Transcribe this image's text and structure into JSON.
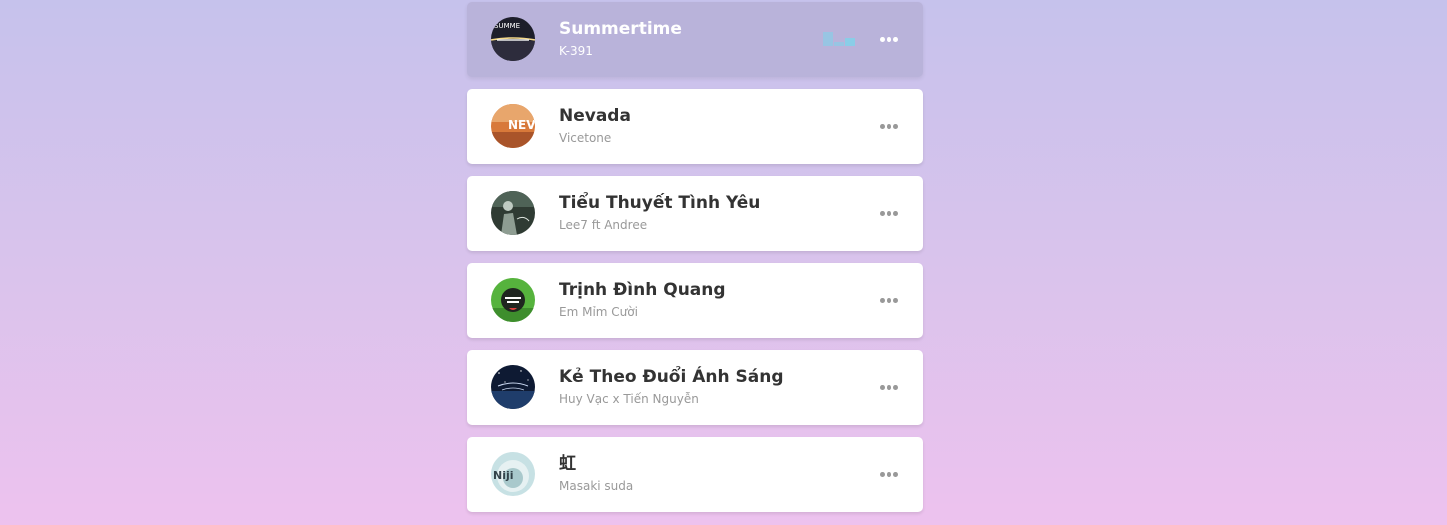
{
  "playlist": [
    {
      "title": "Summertime",
      "author": "K-391",
      "active": true,
      "icon": "more-horizontal-icon"
    },
    {
      "title": "Nevada",
      "author": "Vicetone",
      "active": false,
      "icon": "more-horizontal-icon"
    },
    {
      "title": "Tiểu Thuyết Tình Yêu",
      "author": "Lee7 ft Andree",
      "active": false,
      "icon": "more-horizontal-icon"
    },
    {
      "title": "Trịnh Đình Quang",
      "author": "Em Mỉm Cười",
      "active": false,
      "icon": "more-horizontal-icon"
    },
    {
      "title": "Kẻ Theo Đuổi Ánh Sáng",
      "author": "Huy Vạc x Tiến Nguyễn",
      "active": false,
      "icon": "more-horizontal-icon"
    },
    {
      "title": "虹",
      "author": "Masaki suda",
      "active": false,
      "icon": "more-horizontal-icon"
    }
  ],
  "artwork_text": {
    "summertime": "SUMME",
    "nevada": "NEVA",
    "niji": "Niji"
  },
  "colors": {
    "active_bg": "#b9b3da",
    "equalizer": "#85cfe8",
    "title": "#333333",
    "author": "#999999"
  }
}
